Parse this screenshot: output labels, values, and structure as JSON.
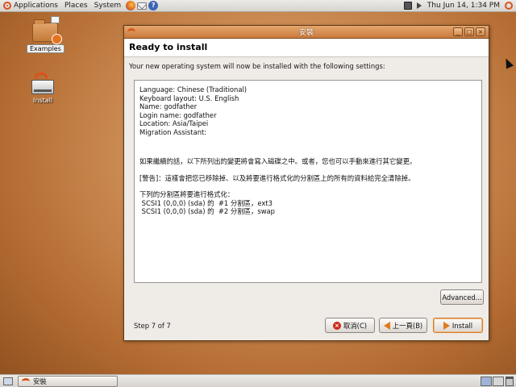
{
  "top_panel": {
    "menus": [
      "Applications",
      "Places",
      "System"
    ],
    "clock": "Thu Jun 14,  1:34 PM",
    "launchers": [
      "firefox-icon",
      "mail-icon",
      "help-icon"
    ],
    "tray_icons": [
      "network-icon",
      "volume-icon",
      "power-icon"
    ]
  },
  "desktop": {
    "icons": [
      {
        "label": "Examples",
        "icon": "folder-icon",
        "selected": true
      },
      {
        "label": "Install",
        "icon": "install-icon",
        "selected": false
      }
    ]
  },
  "window": {
    "title": "安裝",
    "controls": [
      "_",
      "□",
      "×"
    ],
    "banner_title": "Ready to install",
    "intro": "Your new operating system will now be installed with the following settings:",
    "summary": {
      "settings": [
        "Language: Chinese (Traditional)",
        "Keyboard layout: U.S. English",
        "Name: godfather",
        "Login name: godfather",
        "Location: Asia/Taipei",
        "Migration Assistant:"
      ],
      "notice": "如果繼續的話，以下所列出的變更將會寫入磁碟之中。或者，您也可以手動來進行其它變更。",
      "warning": "[警告]：這樣會把您已移除掉、以及將要進行格式化的分割區上的所有的資料給完全清除掉。",
      "format_header": "下列的分割區將要進行格式化：",
      "partitions": [
        " SCSI1 (0,0,0) (sda) 的  #1 分割區，ext3",
        " SCSI1 (0,0,0) (sda) 的  #2 分割區，swap"
      ]
    },
    "advanced_label": "Advanced...",
    "step_label": "Step 7 of 7",
    "cancel_label": "取消(C)",
    "back_label": "上一頁(B)",
    "install_label": "Install"
  },
  "bottom_panel": {
    "task_label": "安裝",
    "workspaces": 2
  }
}
